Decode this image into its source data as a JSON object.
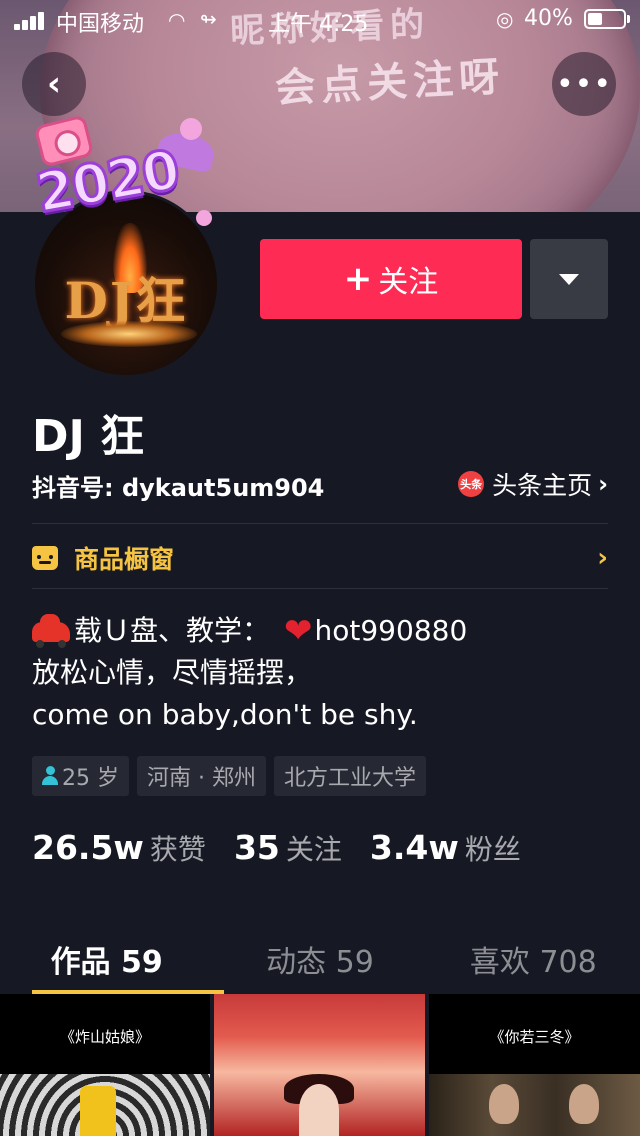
{
  "status_bar": {
    "carrier": "中国移动",
    "time": "上午 4:25",
    "battery_percent": "40%",
    "battery_level": 0.4
  },
  "banner": {
    "text_line1": "昵称好看的",
    "text_line2": "会点关注呀"
  },
  "avatar": {
    "text": "DJ狂",
    "badge_text": "2020"
  },
  "actions": {
    "follow_plus": "+",
    "follow_label": "关注"
  },
  "profile": {
    "name": "DJ 狂",
    "douyin_id": "抖音号: dykaut5um904",
    "toutiao_icon_text": "头条",
    "toutiao_label": "头条主页"
  },
  "shop": {
    "label": "商品橱窗"
  },
  "bio": {
    "line1_text": "载Ｕ盘、教学：",
    "line1_contact": "hot990880",
    "line2": "放松心情，尽情摇摆，",
    "line3": "come on baby,don't be shy."
  },
  "tags": {
    "age": "25 岁",
    "location": "河南 · 郑州",
    "school": "北方工业大学"
  },
  "stats": [
    {
      "value": "26.5w",
      "label": "获赞"
    },
    {
      "value": "35",
      "label": "关注"
    },
    {
      "value": "3.4w",
      "label": "粉丝"
    }
  ],
  "tabs": [
    {
      "label": "作品 59",
      "active": true
    },
    {
      "label": "动态 59",
      "active": false
    },
    {
      "label": "喜欢 708",
      "active": false
    }
  ],
  "thumbnails": [
    {
      "caption": "《炸山姑娘》"
    },
    {
      "caption": ""
    },
    {
      "caption": "《你若三冬》"
    }
  ],
  "colors": {
    "background": "#161823",
    "follow_button": "#fe2c55",
    "accent_yellow": "#f6c443",
    "muted_text": "#a8a9ae"
  },
  "icons": {
    "back": "chevron-left-icon",
    "more": "more-dots-icon",
    "dropdown": "caret-down-icon",
    "shop": "shop-icon",
    "age": "person-icon",
    "bio_heart": "heart-icon",
    "bio_car": "car-icon"
  }
}
